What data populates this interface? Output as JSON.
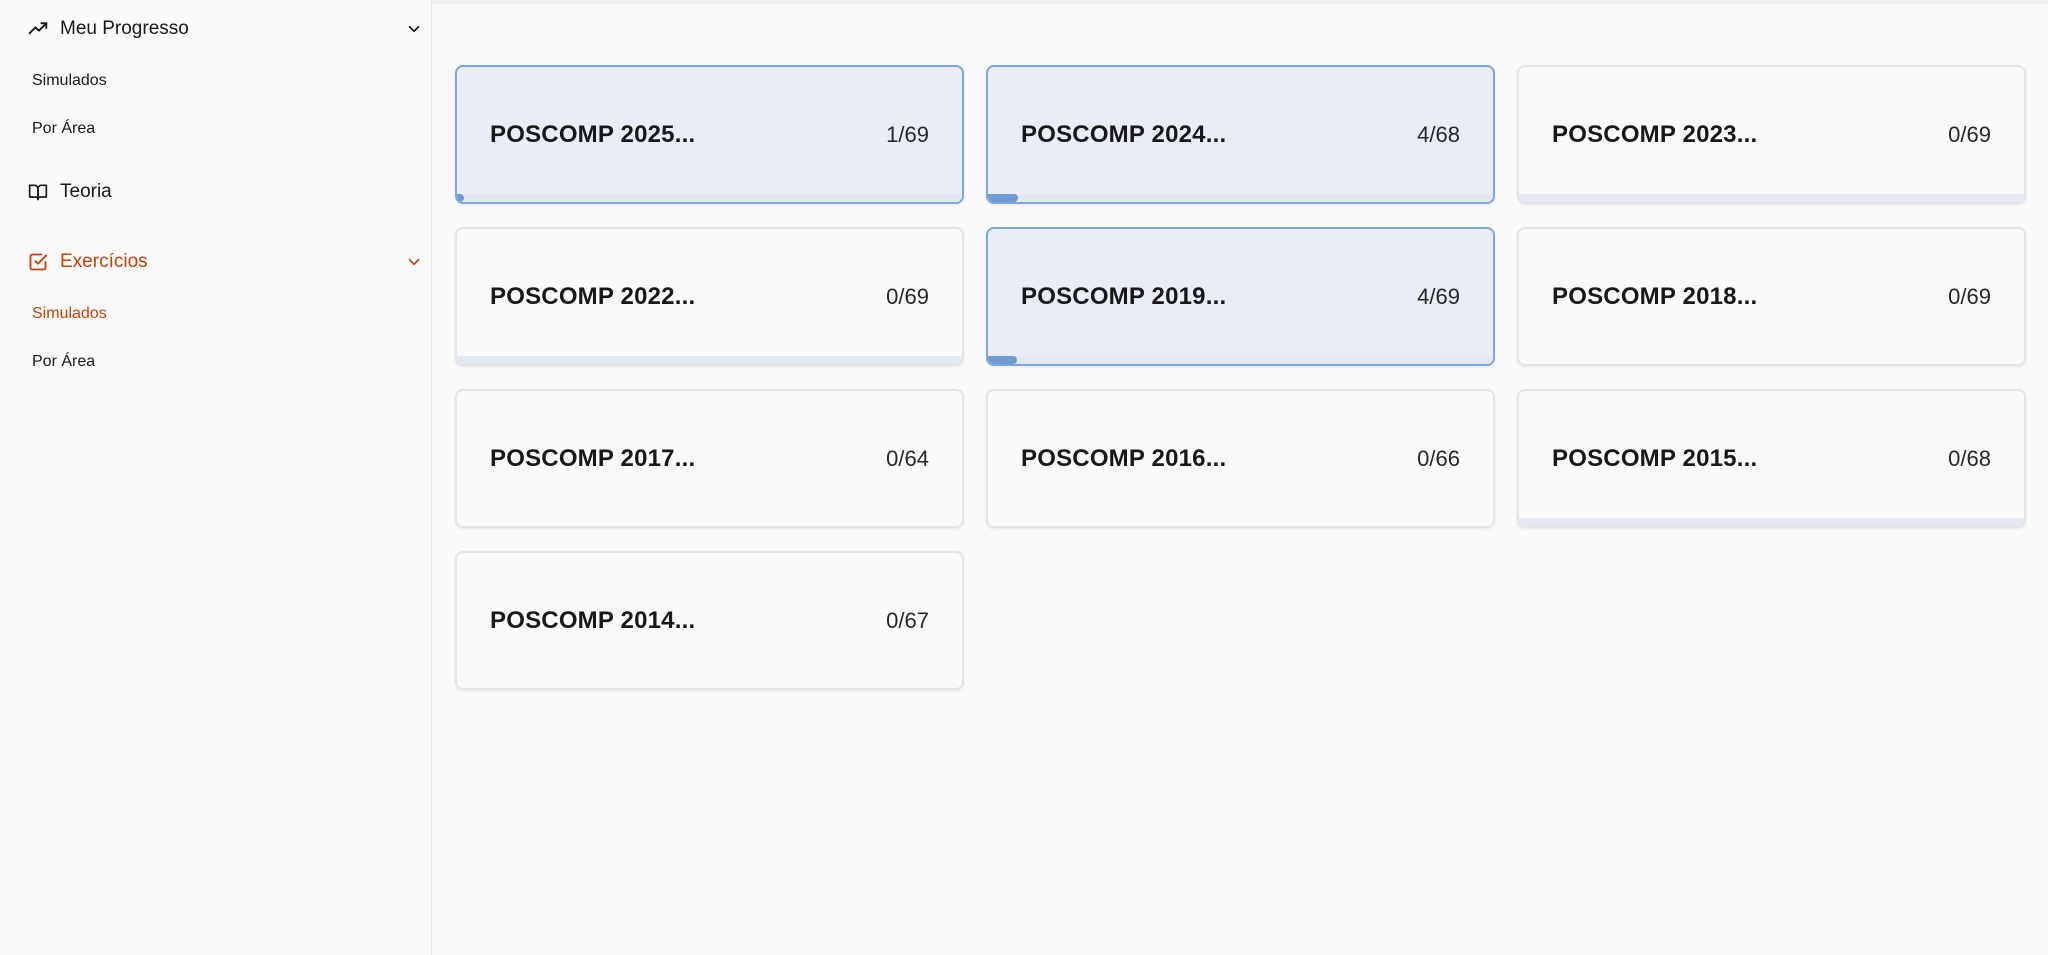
{
  "sidebar": {
    "progress_group": {
      "label": "Meu Progresso",
      "icon": "trending-up-icon"
    },
    "progress_items": [
      {
        "label": "Simulados"
      },
      {
        "label": "Por Área"
      }
    ],
    "theory": {
      "label": "Teoria",
      "icon": "book-open-icon"
    },
    "exercises_group": {
      "label": "Exercícios",
      "icon": "square-check-icon"
    },
    "exercises_items": [
      {
        "label": "Simulados",
        "active": true
      },
      {
        "label": "Por Área",
        "active": false
      }
    ],
    "active_color": "#c2410c"
  },
  "cards": [
    {
      "title": "POSCOMP 2025...",
      "count": "1/69",
      "done": 1,
      "total": 69,
      "highlighted": true,
      "show_track": true
    },
    {
      "title": "POSCOMP 2024...",
      "count": "4/68",
      "done": 4,
      "total": 68,
      "highlighted": true,
      "show_track": true
    },
    {
      "title": "POSCOMP 2023...",
      "count": "0/69",
      "done": 0,
      "total": 69,
      "highlighted": false,
      "show_track": true
    },
    {
      "title": "POSCOMP 2022...",
      "count": "0/69",
      "done": 0,
      "total": 69,
      "highlighted": false,
      "show_track": true
    },
    {
      "title": "POSCOMP 2019...",
      "count": "4/69",
      "done": 4,
      "total": 69,
      "highlighted": true,
      "show_track": true
    },
    {
      "title": "POSCOMP 2018...",
      "count": "0/69",
      "done": 0,
      "total": 69,
      "highlighted": false,
      "show_track": false
    },
    {
      "title": "POSCOMP 2017...",
      "count": "0/64",
      "done": 0,
      "total": 64,
      "highlighted": false,
      "show_track": false
    },
    {
      "title": "POSCOMP 2016...",
      "count": "0/66",
      "done": 0,
      "total": 66,
      "highlighted": false,
      "show_track": false
    },
    {
      "title": "POSCOMP 2015...",
      "count": "0/68",
      "done": 0,
      "total": 68,
      "highlighted": false,
      "show_track": true
    },
    {
      "title": "POSCOMP 2014...",
      "count": "0/67",
      "done": 0,
      "total": 67,
      "highlighted": false,
      "show_track": false
    }
  ],
  "colors": {
    "highlight_bg": "#e8edf7",
    "highlight_border": "#7ea8dd",
    "progress_fill": "#6e9ad3",
    "progress_track": "#e3e8f2"
  }
}
